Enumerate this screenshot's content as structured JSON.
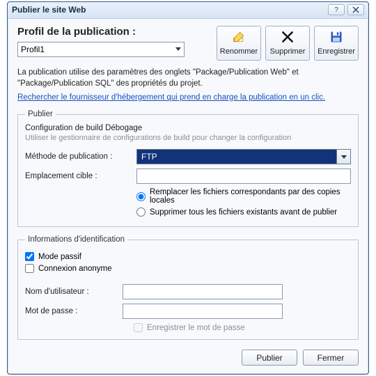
{
  "window": {
    "title": "Publier le site Web"
  },
  "profile": {
    "label": "Profil de la publication :",
    "selected": "Profil1"
  },
  "toolbar": {
    "rename": "Renommer",
    "delete": "Supprimer",
    "save": "Enregistrer"
  },
  "description": "La publication utilise des paramètres des onglets \"Package/Publication Web\" et \"Package/Publication SQL\" des propriétés du projet.",
  "link": "Rechercher le fournisseur d'hébergement qui prend en charge la publication en un clic.",
  "publish": {
    "legend": "Publier",
    "config_title": "Configuration de build Débogage",
    "config_sub": "Utiliser le gestionnaire de configurations de build pour changer la configuration",
    "method_label": "Méthode de publication :",
    "method_value": "FTP",
    "target_label": "Emplacement cible :",
    "target_value": "",
    "opt_replace": "Remplacer les fichiers correspondants par des copies locales",
    "opt_delete": "Supprimer tous les fichiers existants avant de publier",
    "selected_option": "replace"
  },
  "creds": {
    "legend": "Informations d'identification",
    "passive": "Mode passif",
    "passive_checked": true,
    "anon": "Connexion anonyme",
    "anon_checked": false,
    "user_label": "Nom d'utilisateur :",
    "user_value": "",
    "pass_label": "Mot de passe :",
    "pass_value": "",
    "save_pw": "Enregistrer le mot de passe",
    "save_pw_checked": false
  },
  "footer": {
    "publish": "Publier",
    "close": "Fermer"
  }
}
